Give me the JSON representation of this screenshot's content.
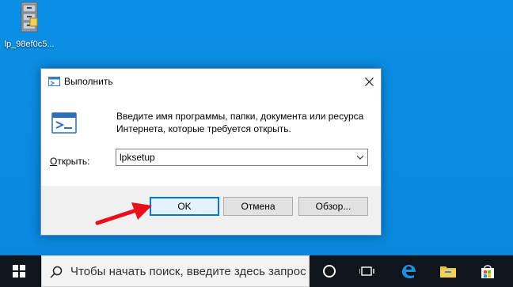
{
  "desktop": {
    "icon_label": "lp_98ef0c5..."
  },
  "dialog": {
    "title": "Выполнить",
    "description": "Введите имя программы, папки, документа или ресурса Интернета, которые требуется открыть.",
    "open_label_prefix": "",
    "open_label_underlined": "О",
    "open_label_rest": "ткрыть:",
    "input_value": "lpksetup",
    "buttons": {
      "ok": "OK",
      "cancel": "Отмена",
      "browse": "Обзор..."
    }
  },
  "taskbar": {
    "search_placeholder": "Чтобы начать поиск, введите здесь запрос"
  },
  "colors": {
    "desktop": "#0a8ae0",
    "accent": "#0078d7",
    "arrow": "#e8101c",
    "taskbar": "#10151c"
  }
}
